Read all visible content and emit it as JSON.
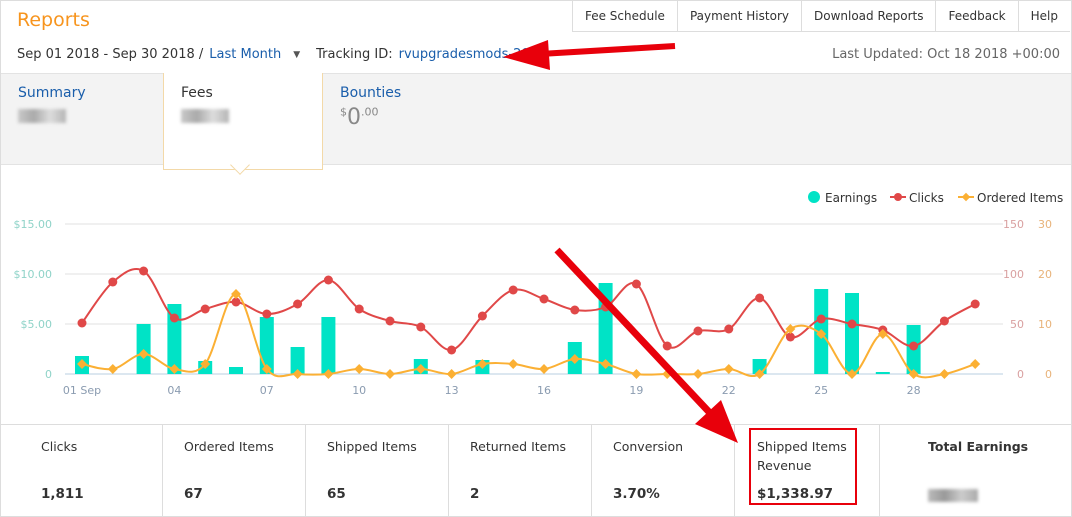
{
  "header": {
    "title": "Reports",
    "nav": [
      "Fee Schedule",
      "Payment History",
      "Download Reports",
      "Feedback",
      "Help"
    ],
    "date_range": "Sep 01 2018 - Sep 30 2018 /",
    "date_preset": "Last Month",
    "tracking_label": "Tracking ID:",
    "tracking_id": "rvupgradesmods-20",
    "last_updated": "Last Updated: Oct 18 2018 +00:00"
  },
  "tabs": [
    {
      "label": "Summary",
      "value_redacted": true
    },
    {
      "label": "Fees",
      "value_redacted": true,
      "active": true
    },
    {
      "label": "Bounties",
      "currency": "$",
      "whole": "0",
      "cents": ".00"
    }
  ],
  "stats": [
    {
      "label": "Clicks",
      "value": "1,811"
    },
    {
      "label": "Ordered Items",
      "value": "67"
    },
    {
      "label": "Shipped Items",
      "value": "65"
    },
    {
      "label": "Returned Items",
      "value": "2"
    },
    {
      "label": "Conversion",
      "value": "3.70%"
    },
    {
      "label": "Shipped Items Revenue",
      "value": "$1,338.97",
      "highlighted": true
    },
    {
      "label": "Total Earnings",
      "value_redacted": true
    }
  ],
  "chart_data": {
    "type": "bar+line",
    "x_ticks": [
      "01 Sep",
      "04",
      "07",
      "10",
      "13",
      "16",
      "19",
      "22",
      "25",
      "28"
    ],
    "days": [
      1,
      2,
      3,
      4,
      5,
      6,
      7,
      8,
      9,
      10,
      11,
      12,
      13,
      14,
      15,
      16,
      17,
      18,
      19,
      20,
      21,
      22,
      23,
      24,
      25,
      26,
      27,
      28,
      29,
      30
    ],
    "y_left": {
      "ticks": [
        "0",
        "$5.00",
        "$10.00",
        "$15.00"
      ],
      "range": [
        0,
        15
      ]
    },
    "y_right1": {
      "ticks": [
        "0",
        "50",
        "100",
        "150"
      ],
      "range": [
        0,
        150
      ]
    },
    "y_right2": {
      "ticks": [
        "0",
        "10",
        "20",
        "30"
      ],
      "range": [
        0,
        30
      ]
    },
    "legend_position": "top-right",
    "grid": true,
    "series": [
      {
        "name": "Earnings",
        "type": "bar",
        "axis": "left",
        "color": "#00e3c6",
        "values": [
          1.8,
          0,
          5.0,
          7.0,
          1.3,
          0.7,
          5.7,
          2.7,
          5.7,
          0,
          0,
          1.5,
          0,
          1.4,
          0,
          0,
          3.2,
          9.1,
          0,
          0,
          0,
          0,
          1.5,
          0,
          8.5,
          8.1,
          0.2,
          4.9,
          0,
          0
        ]
      },
      {
        "name": "Clicks",
        "type": "line",
        "axis": "right1",
        "color": "#e04848",
        "values": [
          51,
          92,
          103,
          56,
          65,
          72,
          60,
          70,
          94,
          65,
          53,
          47,
          24,
          58,
          84,
          75,
          64,
          67,
          90,
          28,
          43,
          45,
          76,
          37,
          55,
          50,
          44,
          28,
          53,
          70
        ]
      },
      {
        "name": "Ordered Items",
        "type": "line",
        "axis": "right2",
        "color": "#fbb034",
        "values": [
          2,
          1,
          4,
          1,
          2,
          16,
          1,
          0,
          0,
          1,
          0,
          1,
          0,
          2,
          2,
          1,
          3,
          2,
          0,
          0,
          0,
          1,
          0,
          9,
          8,
          0,
          8,
          0,
          0,
          2
        ]
      }
    ]
  }
}
